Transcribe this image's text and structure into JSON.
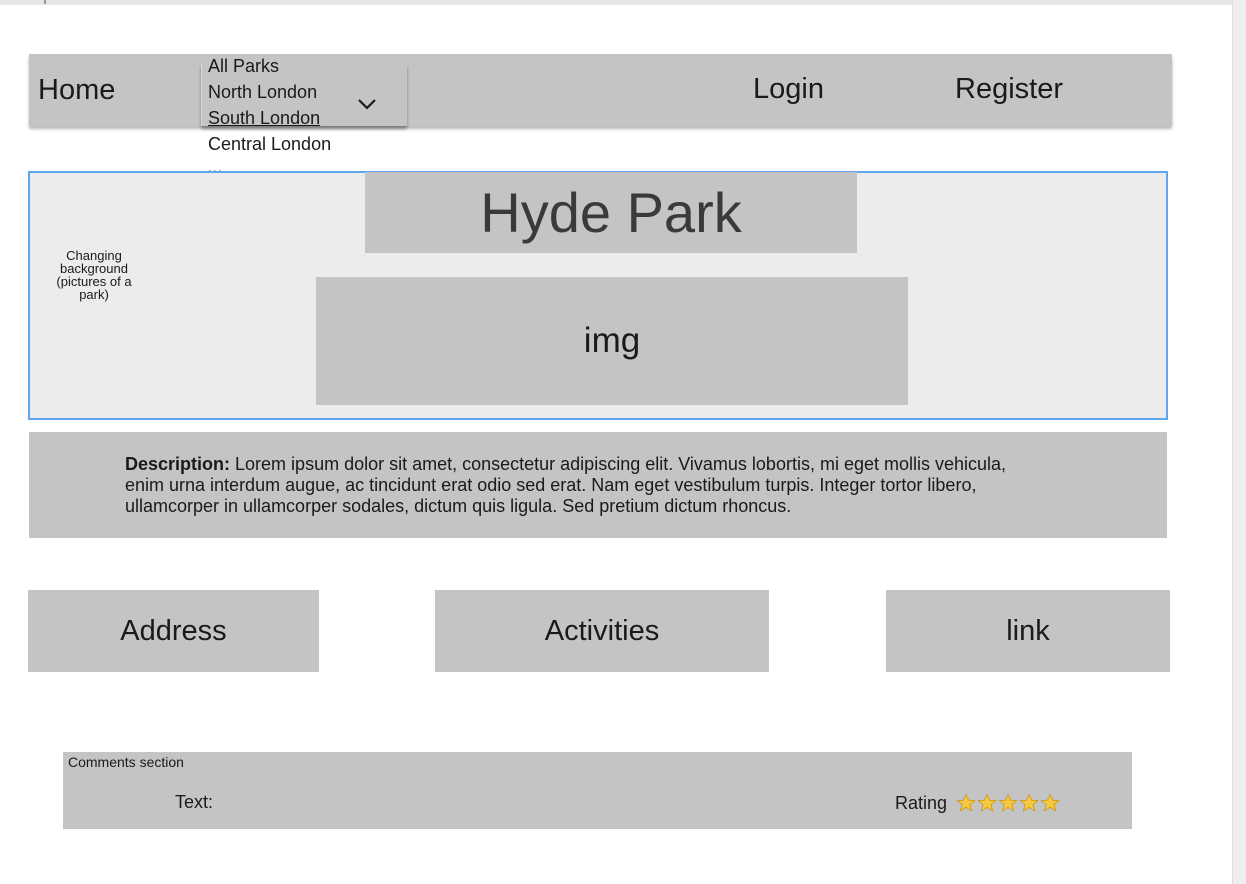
{
  "nav": {
    "home": "Home",
    "login": "Login",
    "register": "Register",
    "parks_options": [
      "All Parks",
      "North London",
      "South London",
      "Central London"
    ],
    "parks_more": "..."
  },
  "hero": {
    "note": "Changing background (pictures of a park)",
    "title": "Hyde Park",
    "image_placeholder": "img"
  },
  "description": {
    "label": "Description:",
    "lines": [
      "Lorem ipsum dolor sit amet, consectetur adipiscing elit. Vivamus lobortis, mi eget mollis vehicula,",
      "enim urna interdum augue, ac tincidunt erat odio sed erat. Nam eget vestibulum turpis. Integer tortor libero,",
      "ullamcorper in ullamcorper sodales, dictum quis ligula. Sed pretium dictum rhoncus."
    ]
  },
  "info_buttons": {
    "address": "Address",
    "activities": "Activities",
    "link": "link"
  },
  "comments": {
    "title": "Comments section",
    "text_label": "Text:",
    "rating_label": "Rating",
    "rating_stars": 5,
    "star_color": "#f5c842"
  },
  "colors": {
    "panel": "#c4c4c4",
    "hero_bg": "#ececec",
    "hero_border": "#5ea6ef"
  }
}
